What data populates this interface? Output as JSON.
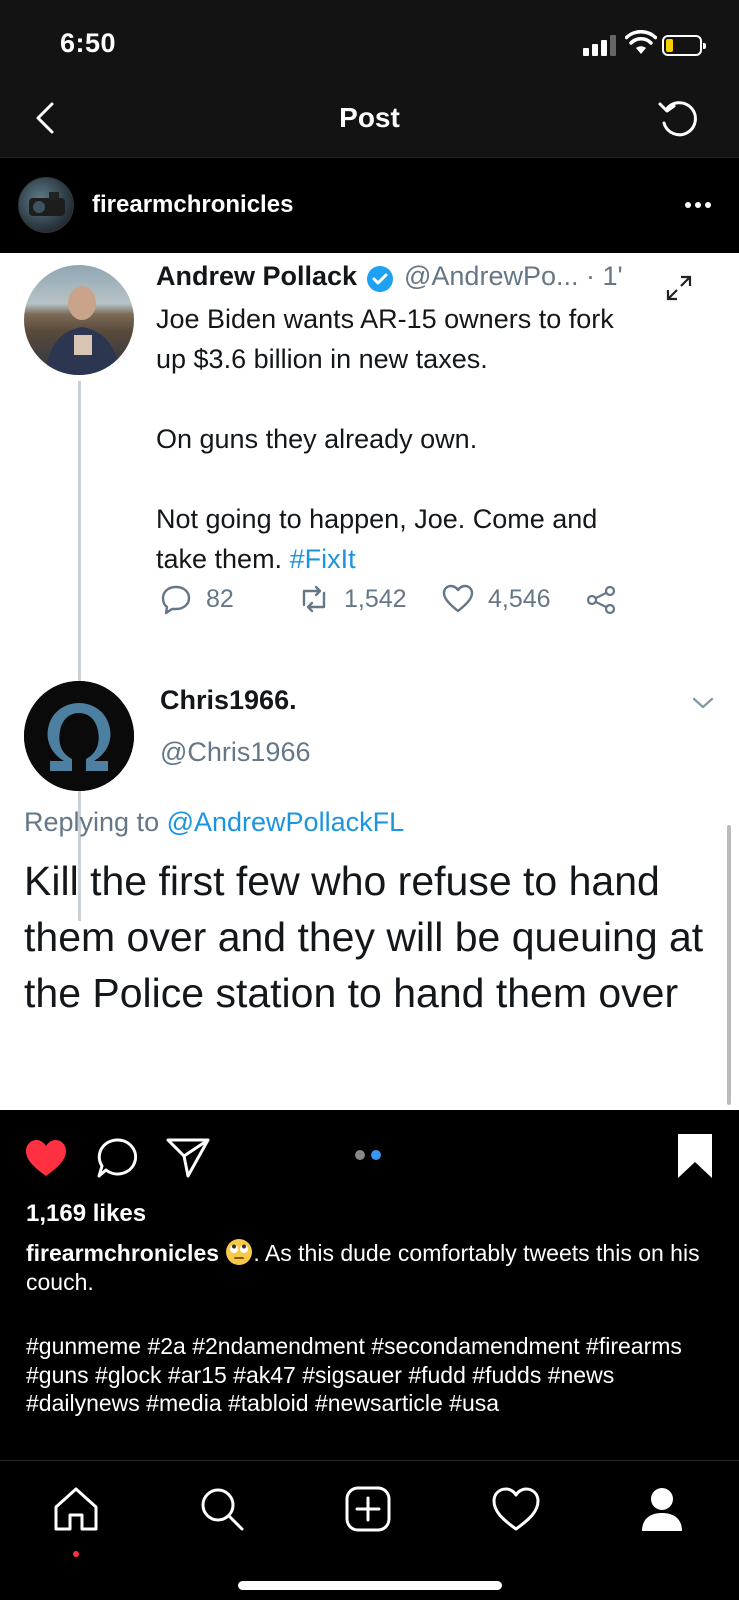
{
  "status_bar": {
    "time": "6:50"
  },
  "header": {
    "title": "Post"
  },
  "post": {
    "username": "firearmchronicles",
    "tweet": {
      "author_name": "Andrew Pollack",
      "author_handle_time": "@AndrewPo... · 1'",
      "lines": [
        "Joe Biden wants AR-15 owners to fork",
        "up $3.6 billion in new taxes."
      ],
      "line3": "On guns they already own.",
      "line4a": "Not going to happen, Joe. Come and",
      "line4b": "take them. ",
      "hashtag": "#FixIt",
      "replies": "82",
      "retweets": "1,542",
      "likes": "4,546"
    },
    "reply": {
      "author_name": "Chris1966.",
      "author_handle": "@Chris1966",
      "replying_prefix": "Replying to ",
      "replying_to": "@AndrewPollackFL",
      "text": "Kill the first few who refuse to hand them over and they will be queuing at the Police station to hand them over"
    },
    "carousel": {
      "total": 2,
      "active": 2
    },
    "likes_text": "1,169 likes",
    "caption_user": "firearmchronicles",
    "caption_text": ". As this dude comfortably tweets this on his couch.",
    "hashtags": "#gunmeme #2a #2ndamendment #secondamendment #firearms #guns #glock #ar15 #ak47 #sigsauer #fudd #fudds #news #dailynews #media #tabloid #newsarticle #usa"
  },
  "colors": {
    "like_red": "#ff3040",
    "twitter_blue": "#1b95e0",
    "carousel_active": "#3897f0"
  },
  "icons": {
    "back": "chevron-left-icon",
    "refresh": "refresh-icon",
    "more": "more-horizontal-icon",
    "like": "heart-filled-icon",
    "comment": "comment-icon",
    "share": "send-icon",
    "save": "bookmark-filled-icon",
    "tabs": [
      "home-icon",
      "search-icon",
      "add-icon",
      "heart-icon",
      "profile-icon"
    ]
  }
}
